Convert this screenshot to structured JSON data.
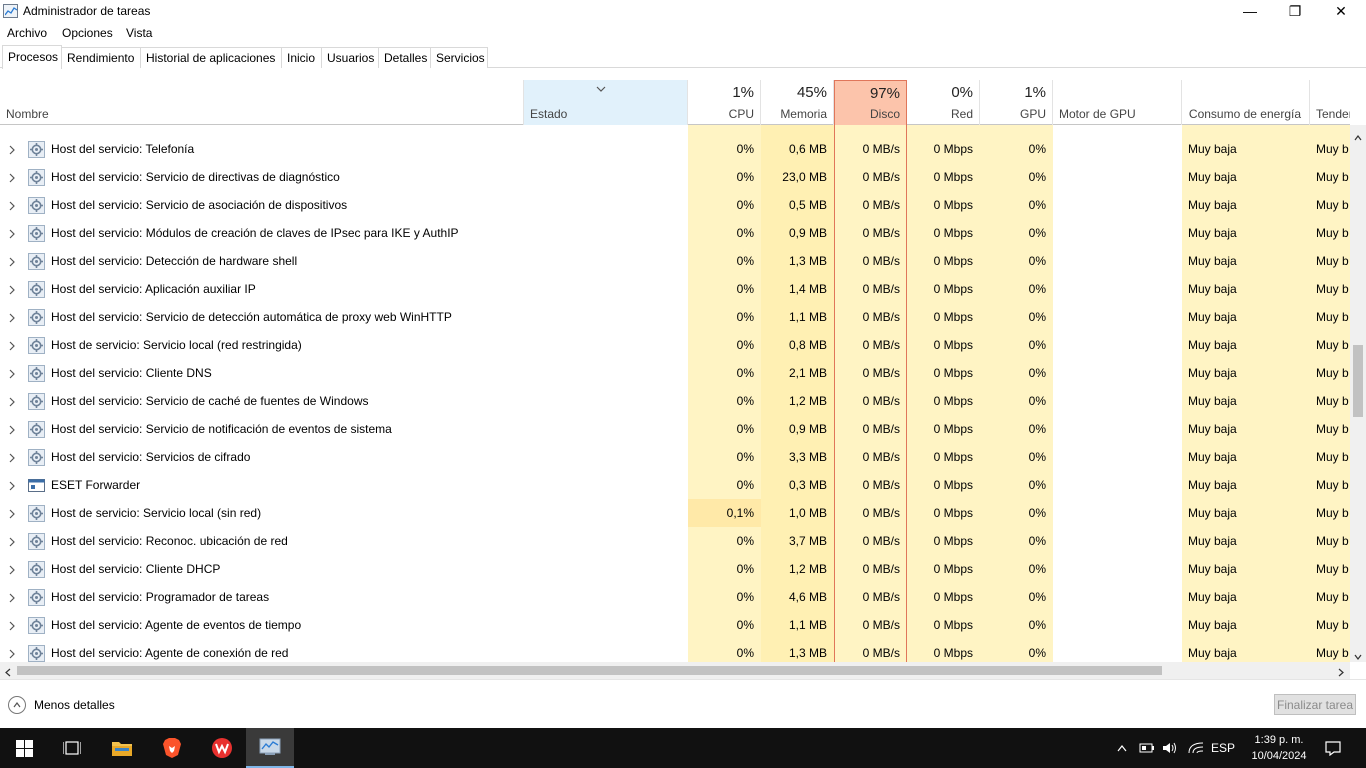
{
  "window": {
    "title": "Administrador de tareas",
    "controls": {
      "minimize": "—",
      "maximize": "❐",
      "close": "✕"
    }
  },
  "menu": [
    "Archivo",
    "Opciones",
    "Vista"
  ],
  "tabs": [
    "Procesos",
    "Rendimiento",
    "Historial de aplicaciones",
    "Inicio",
    "Usuarios",
    "Detalles",
    "Servicios"
  ],
  "active_tab": "Procesos",
  "columns": {
    "name": "Nombre",
    "status": "Estado",
    "cpu": {
      "pct": "1%",
      "label": "CPU"
    },
    "memory": {
      "pct": "45%",
      "label": "Memoria"
    },
    "disk": {
      "pct": "97%",
      "label": "Disco"
    },
    "network": {
      "pct": "0%",
      "label": "Red"
    },
    "gpu": {
      "pct": "1%",
      "label": "GPU"
    },
    "gpu_engine": "Motor de GPU",
    "power": "Consumo de energía",
    "trend": "Tendenci"
  },
  "processes": [
    {
      "name": "Host del servicio: Telefonía",
      "cpu": "0%",
      "mem": "0,6 MB",
      "disk": "0 MB/s",
      "net": "0 Mbps",
      "gpu": "0%",
      "power": "Muy baja",
      "trend": "Muy b",
      "icon": "gear-icon"
    },
    {
      "name": "Host del servicio: Servicio de directivas de diagnóstico",
      "cpu": "0%",
      "mem": "23,0 MB",
      "disk": "0 MB/s",
      "net": "0 Mbps",
      "gpu": "0%",
      "power": "Muy baja",
      "trend": "Muy b",
      "icon": "gear-icon"
    },
    {
      "name": "Host del servicio: Servicio de asociación de dispositivos",
      "cpu": "0%",
      "mem": "0,5 MB",
      "disk": "0 MB/s",
      "net": "0 Mbps",
      "gpu": "0%",
      "power": "Muy baja",
      "trend": "Muy b",
      "icon": "gear-icon"
    },
    {
      "name": "Host del servicio: Módulos de creación de claves de IPsec para IKE y AuthIP",
      "cpu": "0%",
      "mem": "0,9 MB",
      "disk": "0 MB/s",
      "net": "0 Mbps",
      "gpu": "0%",
      "power": "Muy baja",
      "trend": "Muy b",
      "icon": "gear-icon"
    },
    {
      "name": "Host del servicio: Detección de hardware shell",
      "cpu": "0%",
      "mem": "1,3 MB",
      "disk": "0 MB/s",
      "net": "0 Mbps",
      "gpu": "0%",
      "power": "Muy baja",
      "trend": "Muy b",
      "icon": "gear-icon"
    },
    {
      "name": "Host del servicio: Aplicación auxiliar IP",
      "cpu": "0%",
      "mem": "1,4 MB",
      "disk": "0 MB/s",
      "net": "0 Mbps",
      "gpu": "0%",
      "power": "Muy baja",
      "trend": "Muy b",
      "icon": "gear-icon"
    },
    {
      "name": "Host del servicio: Servicio de detección automática de proxy web WinHTTP",
      "cpu": "0%",
      "mem": "1,1 MB",
      "disk": "0 MB/s",
      "net": "0 Mbps",
      "gpu": "0%",
      "power": "Muy baja",
      "trend": "Muy b",
      "icon": "gear-icon"
    },
    {
      "name": "Host de servicio: Servicio local (red restringida)",
      "cpu": "0%",
      "mem": "0,8 MB",
      "disk": "0 MB/s",
      "net": "0 Mbps",
      "gpu": "0%",
      "power": "Muy baja",
      "trend": "Muy b",
      "icon": "gear-icon"
    },
    {
      "name": "Host del servicio: Cliente DNS",
      "cpu": "0%",
      "mem": "2,1 MB",
      "disk": "0 MB/s",
      "net": "0 Mbps",
      "gpu": "0%",
      "power": "Muy baja",
      "trend": "Muy b",
      "icon": "gear-icon"
    },
    {
      "name": "Host del servicio: Servicio de caché de fuentes de Windows",
      "cpu": "0%",
      "mem": "1,2 MB",
      "disk": "0 MB/s",
      "net": "0 Mbps",
      "gpu": "0%",
      "power": "Muy baja",
      "trend": "Muy b",
      "icon": "gear-icon"
    },
    {
      "name": "Host del servicio: Servicio de notificación de eventos de sistema",
      "cpu": "0%",
      "mem": "0,9 MB",
      "disk": "0 MB/s",
      "net": "0 Mbps",
      "gpu": "0%",
      "power": "Muy baja",
      "trend": "Muy b",
      "icon": "gear-icon"
    },
    {
      "name": "Host del servicio: Servicios de cifrado",
      "cpu": "0%",
      "mem": "3,3 MB",
      "disk": "0 MB/s",
      "net": "0 Mbps",
      "gpu": "0%",
      "power": "Muy baja",
      "trend": "Muy b",
      "icon": "gear-icon"
    },
    {
      "name": "ESET Forwarder",
      "cpu": "0%",
      "mem": "0,3 MB",
      "disk": "0 MB/s",
      "net": "0 Mbps",
      "gpu": "0%",
      "power": "Muy baja",
      "trend": "Muy b",
      "icon": "app-window-icon"
    },
    {
      "name": "Host de servicio: Servicio local (sin red)",
      "cpu": "0,1%",
      "mem": "1,0 MB",
      "disk": "0 MB/s",
      "net": "0 Mbps",
      "gpu": "0%",
      "power": "Muy baja",
      "trend": "Muy b",
      "icon": "gear-icon"
    },
    {
      "name": "Host del servicio: Reconoc. ubicación de red",
      "cpu": "0%",
      "mem": "3,7 MB",
      "disk": "0 MB/s",
      "net": "0 Mbps",
      "gpu": "0%",
      "power": "Muy baja",
      "trend": "Muy b",
      "icon": "gear-icon"
    },
    {
      "name": "Host del servicio: Cliente DHCP",
      "cpu": "0%",
      "mem": "1,2 MB",
      "disk": "0 MB/s",
      "net": "0 Mbps",
      "gpu": "0%",
      "power": "Muy baja",
      "trend": "Muy b",
      "icon": "gear-icon"
    },
    {
      "name": "Host del servicio: Programador de tareas",
      "cpu": "0%",
      "mem": "4,6 MB",
      "disk": "0 MB/s",
      "net": "0 Mbps",
      "gpu": "0%",
      "power": "Muy baja",
      "trend": "Muy b",
      "icon": "gear-icon"
    },
    {
      "name": "Host del servicio: Agente de eventos de tiempo",
      "cpu": "0%",
      "mem": "1,1 MB",
      "disk": "0 MB/s",
      "net": "0 Mbps",
      "gpu": "0%",
      "power": "Muy baja",
      "trend": "Muy b",
      "icon": "gear-icon"
    },
    {
      "name": "Host del servicio: Agente de conexión de red",
      "cpu": "0%",
      "mem": "1,3 MB",
      "disk": "0 MB/s",
      "net": "0 Mbps",
      "gpu": "0%",
      "power": "Muy baja",
      "trend": "Muy b",
      "icon": "gear-icon"
    }
  ],
  "footer": {
    "less_details": "Menos detalles",
    "end_task": "Finalizar tarea"
  },
  "taskbar": {
    "language": "ESP",
    "time": "1:39 p. m.",
    "date": "10/04/2024"
  },
  "colors": {
    "cpu_bg": "#fff4c4",
    "mem_bg": "#fff0b3",
    "disk_bg": "#fff4c4",
    "disk_header": "#fcc4ab",
    "cpu_hot": "#ffe9a8",
    "status_header": "#e1f1fb"
  }
}
